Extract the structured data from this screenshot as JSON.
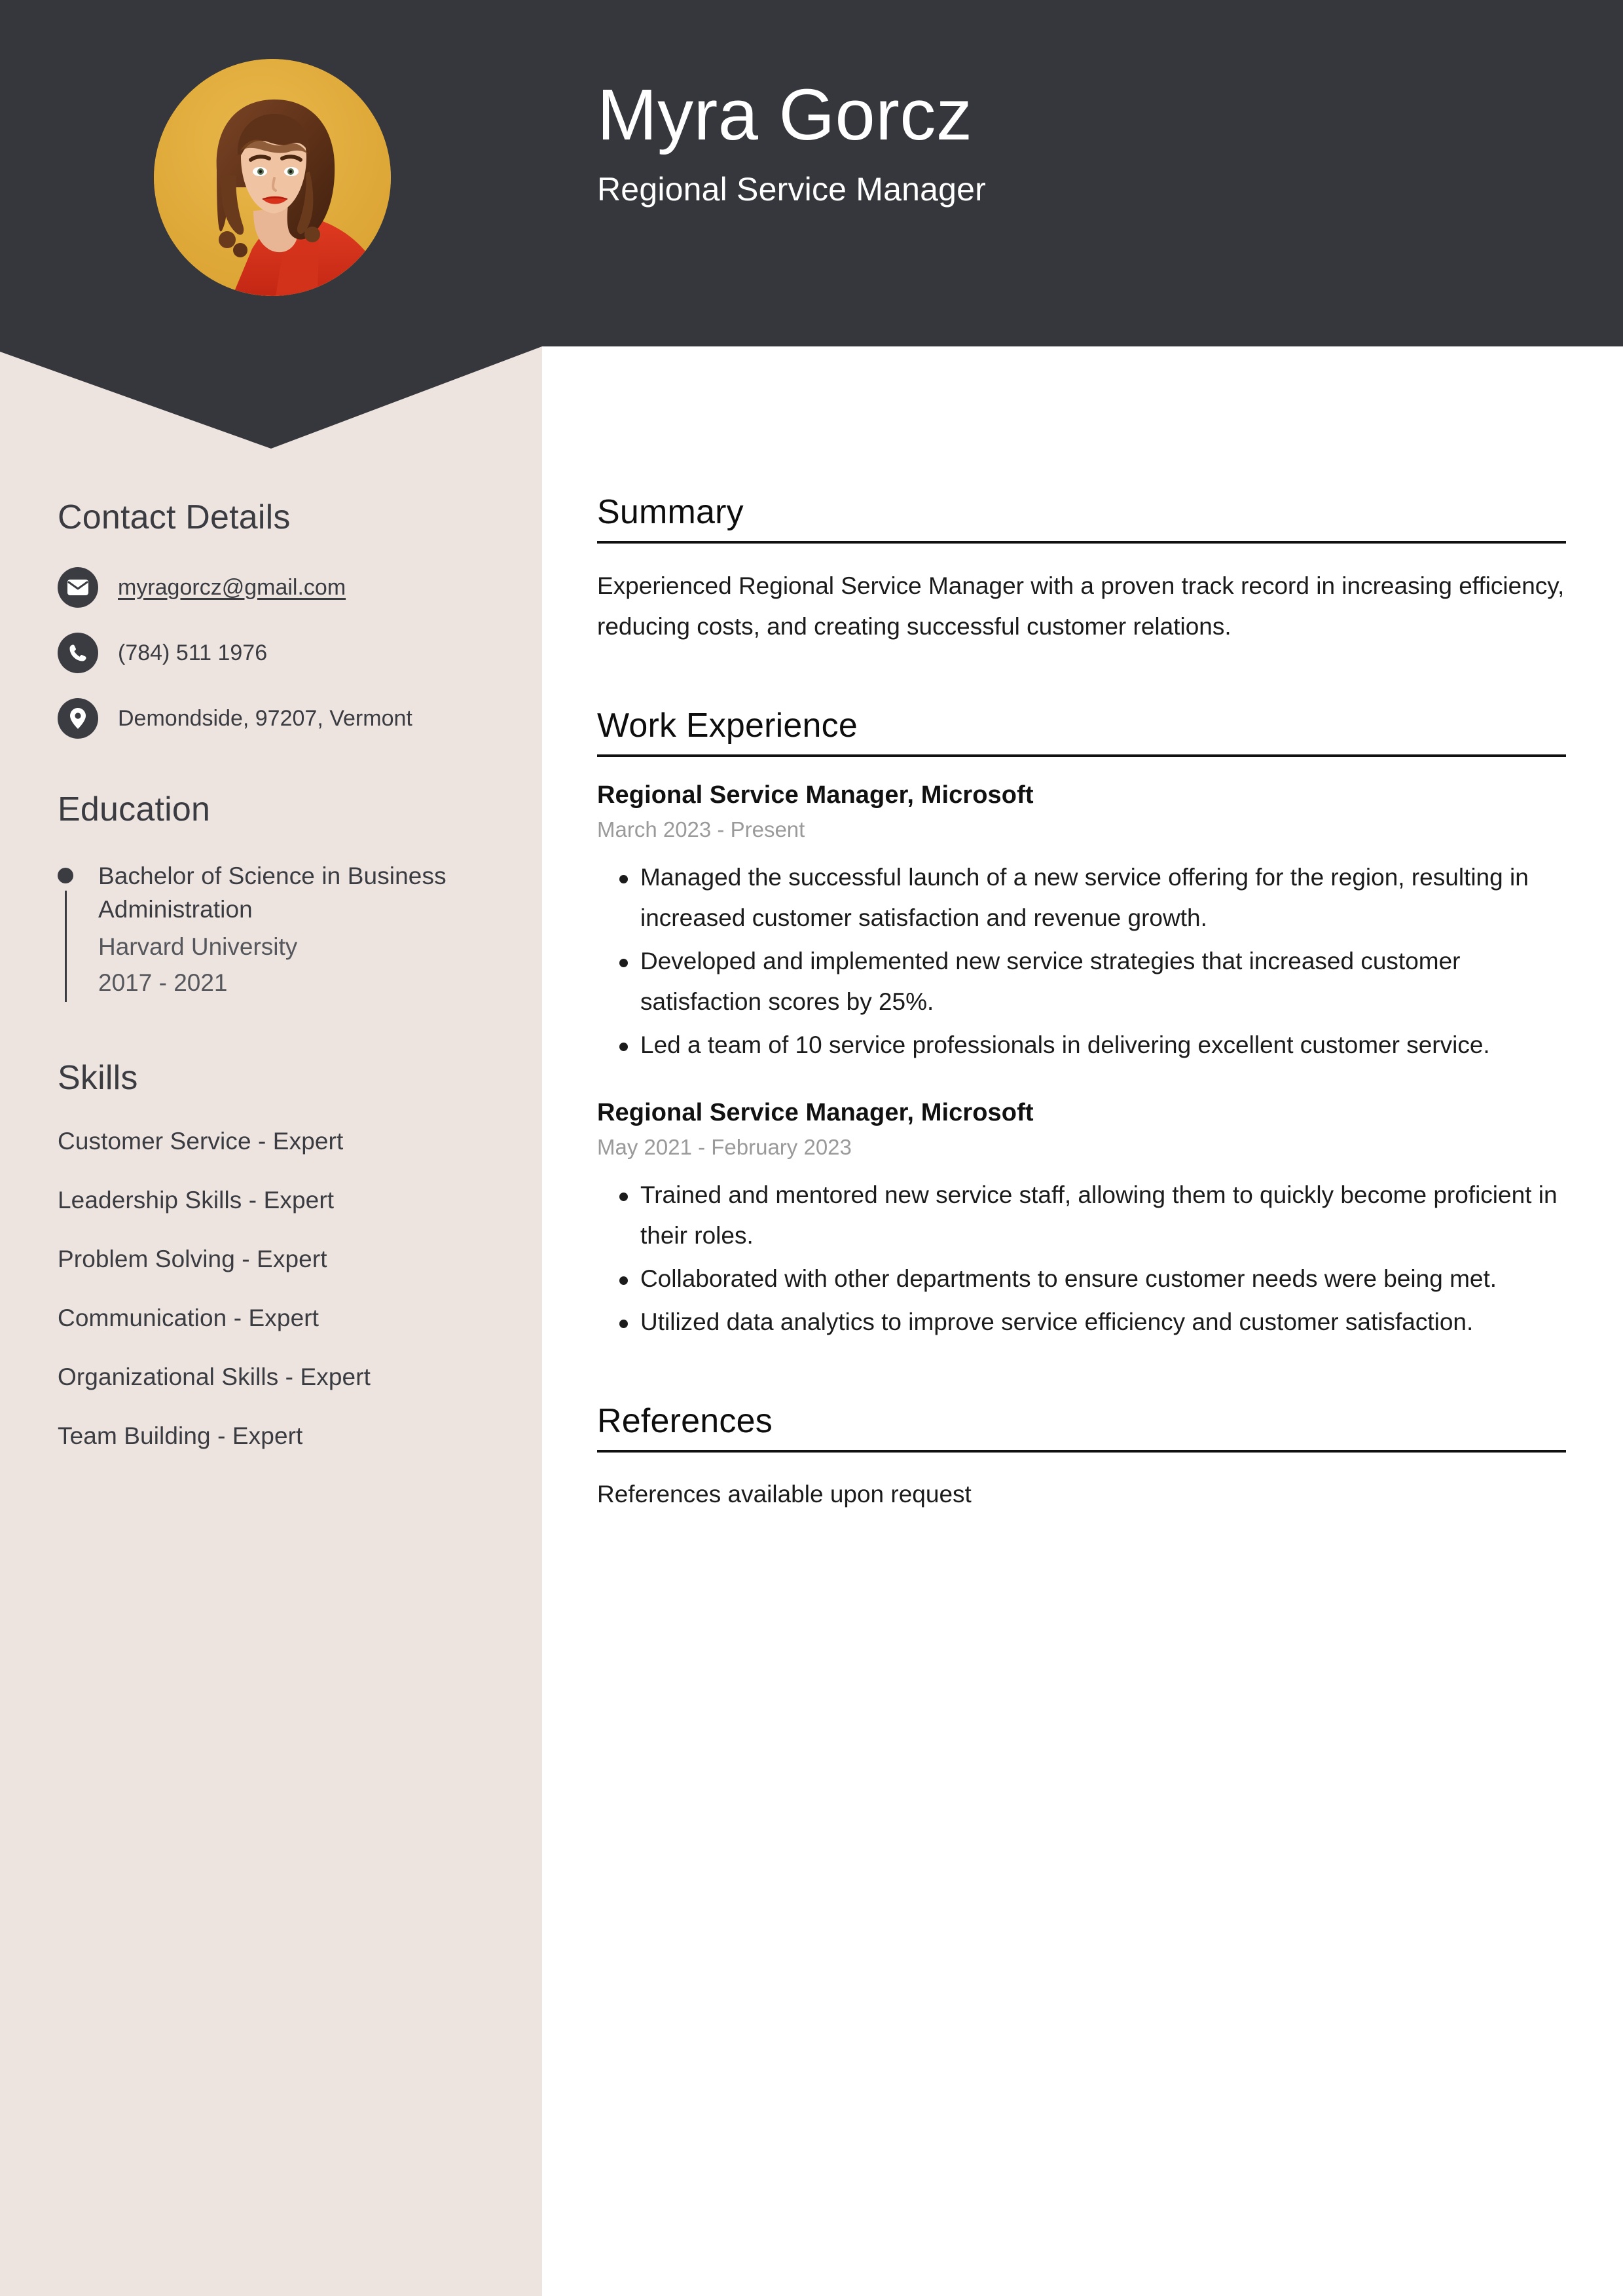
{
  "header": {
    "name": "Myra Gorcz",
    "job_title": "Regional Service Manager",
    "background_color": "#35373D",
    "text_color": "#FFFFFF",
    "avatar_background_color": "#E3AC3C",
    "avatar_alt": "portrait-photo"
  },
  "theme": {
    "sidebar_background": "#EDE4DF",
    "main_background": "#FFFFFF",
    "sidebar_text": "#3A3C42",
    "main_text": "#1B1B1B",
    "muted_text": "#9A9A9A",
    "rule_color": "#111111"
  },
  "sidebar": {
    "contact": {
      "heading": "Contact Details",
      "items": [
        {
          "icon": "envelope-icon",
          "value": "myragorcz@gmail.com",
          "type": "email"
        },
        {
          "icon": "phone-icon",
          "value": "(784) 511 1976",
          "type": "phone"
        },
        {
          "icon": "map-pin-icon",
          "value": "Demondside, 97207, Vermont",
          "type": "location"
        }
      ]
    },
    "education": {
      "heading": "Education",
      "items": [
        {
          "degree": "Bachelor of Science in Business Administration",
          "school": "Harvard University",
          "dates": "2017 - 2021"
        }
      ]
    },
    "skills": {
      "heading": "Skills",
      "items": [
        "Customer Service - Expert",
        "Leadership Skills - Expert",
        "Problem Solving - Expert",
        "Communication - Expert",
        "Organizational Skills - Expert",
        "Team Building - Expert"
      ]
    }
  },
  "main": {
    "summary": {
      "heading": "Summary",
      "text": "Experienced Regional Service Manager with a proven track record in increasing efficiency, reducing costs, and creating successful customer relations."
    },
    "work_experience": {
      "heading": "Work Experience",
      "jobs": [
        {
          "role": "Regional Service Manager, Microsoft",
          "dates": "March 2023 - Present",
          "bullets": [
            "Managed the successful launch of a new service offering for the region, resulting in increased customer satisfaction and revenue growth.",
            "Developed and implemented new service strategies that increased customer satisfaction scores by 25%.",
            "Led a team of 10 service professionals in delivering excellent customer service."
          ]
        },
        {
          "role": "Regional Service Manager, Microsoft",
          "dates": "May 2021 - February 2023",
          "bullets": [
            "Trained and mentored new service staff, allowing them to quickly become proficient in their roles.",
            "Collaborated with other departments to ensure customer needs were being met.",
            "Utilized data analytics to improve service efficiency and customer satisfaction."
          ]
        }
      ]
    },
    "references": {
      "heading": "References",
      "text": "References available upon request"
    }
  }
}
